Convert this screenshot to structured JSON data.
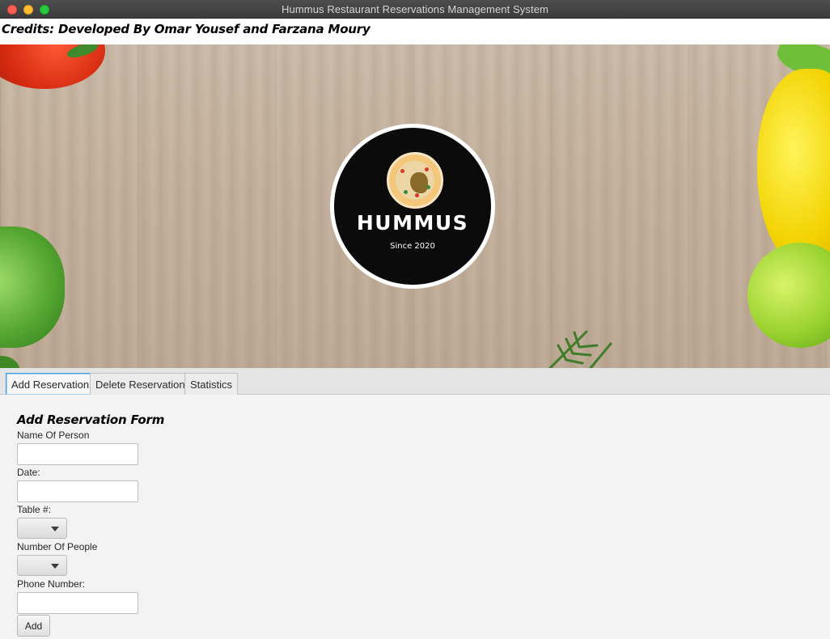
{
  "window": {
    "title": "Hummus Restaurant Reservations Management System"
  },
  "credits": "Credits: Developed By Omar Yousef and Farzana Moury",
  "logo": {
    "title": "HUMMUS",
    "subtitle": "Since 2020"
  },
  "tabs": [
    {
      "label": "Add Reservation",
      "active": true
    },
    {
      "label": "Delete Reservation",
      "active": false
    },
    {
      "label": "Statistics",
      "active": false
    }
  ],
  "form": {
    "title": "Add Reservation Form",
    "name_label": "Name Of Person",
    "name_value": "",
    "date_label": "Date:",
    "date_value": "",
    "table_label": "Table #:",
    "table_value": "",
    "people_label": "Number Of People",
    "people_value": "",
    "phone_label": "Phone Number:",
    "phone_value": "",
    "add_button": "Add"
  },
  "icons": {
    "window_close": "close-icon",
    "window_minimize": "minimize-icon",
    "window_maximize": "maximize-icon",
    "dropdown": "chevron-down-icon"
  },
  "colors": {
    "active_tab_border": "#3d9be6",
    "titlebar": "#3c3c3c"
  }
}
